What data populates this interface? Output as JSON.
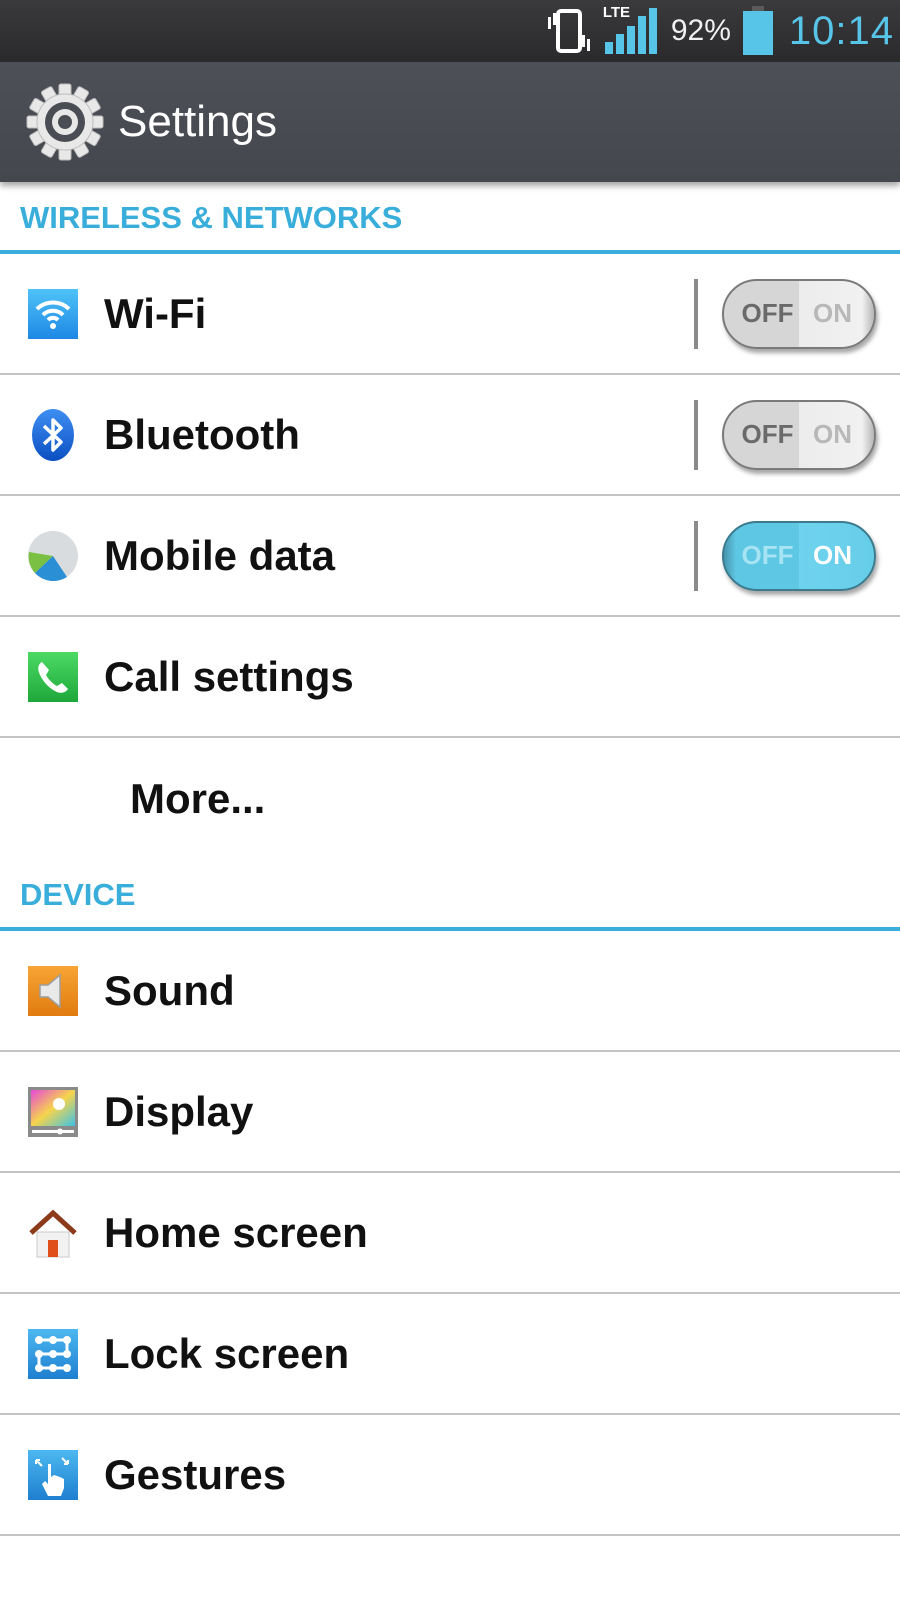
{
  "status_bar": {
    "network_type": "LTE",
    "battery_percent": "92%",
    "battery_level": 0.92,
    "time": "10:14",
    "icons": [
      "vibrate-icon",
      "signal-icon",
      "battery-icon"
    ]
  },
  "action_bar": {
    "title": "Settings",
    "icon": "gear-icon"
  },
  "sections": {
    "wireless": {
      "header": "WIRELESS & NETWORKS",
      "items": [
        {
          "label": "Wi-Fi",
          "icon": "wifi-icon",
          "toggle": {
            "state": "off",
            "off_label": "OFF",
            "on_label": "ON"
          }
        },
        {
          "label": "Bluetooth",
          "icon": "bluetooth-icon",
          "toggle": {
            "state": "off",
            "off_label": "OFF",
            "on_label": "ON"
          }
        },
        {
          "label": "Mobile data",
          "icon": "mobile-data-icon",
          "toggle": {
            "state": "on",
            "off_label": "OFF",
            "on_label": "ON"
          }
        },
        {
          "label": "Call settings",
          "icon": "phone-icon"
        },
        {
          "label": "More..."
        }
      ]
    },
    "device": {
      "header": "DEVICE",
      "items": [
        {
          "label": "Sound",
          "icon": "speaker-icon"
        },
        {
          "label": "Display",
          "icon": "display-icon"
        },
        {
          "label": "Home screen",
          "icon": "home-icon"
        },
        {
          "label": "Lock screen",
          "icon": "lock-pattern-icon"
        },
        {
          "label": "Gestures",
          "icon": "gesture-hand-icon"
        }
      ]
    }
  },
  "colors": {
    "accent": "#3aaedb",
    "action_bar": "#4a4d53",
    "status_bar": "#2f2f31",
    "time": "#56c5e8",
    "toggle_on": "#5ec7e4"
  }
}
